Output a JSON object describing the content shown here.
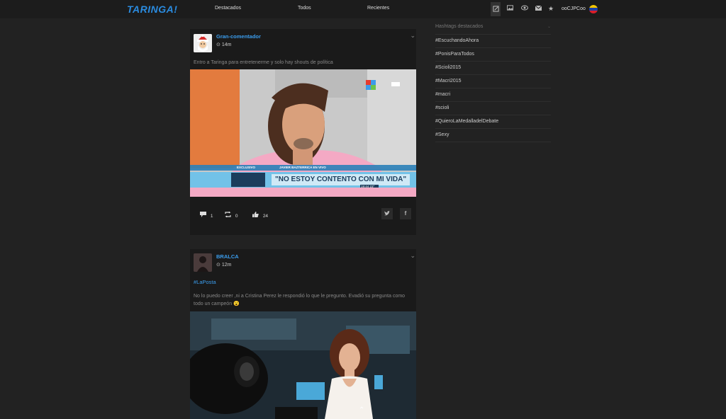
{
  "header": {
    "logo": "TARINGA!",
    "nav": [
      "Destacados",
      "Todos",
      "Recientes"
    ],
    "username": "ooCJPCoo",
    "icons": [
      "compose-icon",
      "image-icon",
      "eye-icon",
      "mail-icon",
      "star-icon"
    ]
  },
  "posts": [
    {
      "author": "Gran-comentador",
      "time": "14m",
      "text": "Entro a Taringa para entretenerme y solo hay shouts de política",
      "caption_tag": "EXCLUSIVO",
      "caption_sub": "JAVIER BAZTERRICA EN VIVO",
      "caption_main": "\"NO ESTOY CONTENTO CON MI VIDA\"",
      "caption_time": "19:44  23°",
      "comments": "1",
      "reshares": "0",
      "likes": "24"
    },
    {
      "author": "BRALCA",
      "time": "12m",
      "hashtag": "#LaPosta",
      "text": "No lo puedo creer ,ni a Cristina Perez le respondió lo que le pregunto. Evadió su pregunta como todo un campeón 😮"
    }
  ],
  "sidebar": {
    "title": "Hashtags destacados",
    "items": [
      "#EscuchandoAhora",
      "#PonisParaTodos",
      "#Scioli2015",
      "#Macri2015",
      "#macri",
      "#scioli",
      "#QuieroLaMedalladelDebate",
      "#Sexy"
    ]
  },
  "colors": {
    "accent": "#3b9ded",
    "logo": "#2a8bdf",
    "background": "#222222",
    "card": "#1a1a1a"
  }
}
